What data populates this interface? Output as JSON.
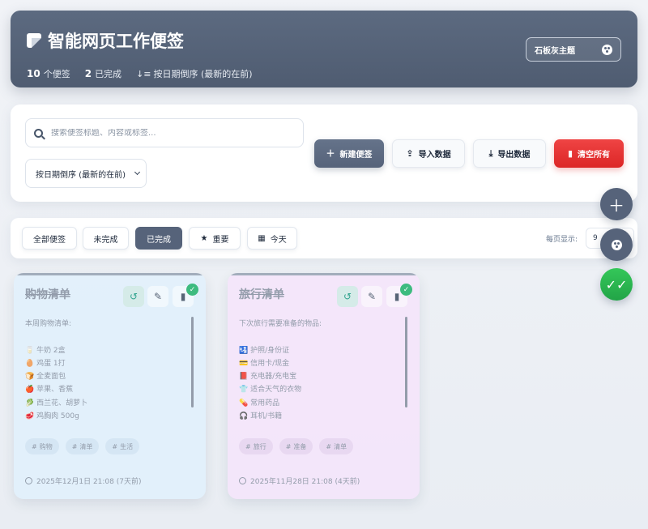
{
  "header": {
    "title": "智能网页工作便签",
    "stats": [
      {
        "count": "10",
        "label": "个便签"
      },
      {
        "count": "2",
        "label": "已完成"
      }
    ],
    "sort_label": "按日期倒序 (最新的在前)",
    "theme_label": "石板灰主题"
  },
  "toolbar": {
    "search_placeholder": "搜索便签标题、内容或标签...",
    "sort_value": "按日期倒序 (最新的在前)",
    "new_label": "新建便签",
    "import_label": "导入数据",
    "export_label": "导出数据",
    "clear_label": "清空所有"
  },
  "filters": {
    "items": [
      "全部便签",
      "未完成",
      "已完成",
      "重要",
      "今天"
    ],
    "active": "已完成",
    "per_page_label": "每页显示:",
    "per_page_value": "9"
  },
  "notes": [
    {
      "title": "购物清单",
      "content": "本周购物清单:\n\n🥛 牛奶 2盒\n🥚 鸡蛋 1打\n🍞 全麦面包\n🍎 苹果、香蕉\n🥬 西兰花、胡萝卜\n🥩 鸡胸肉 500g",
      "tags": [
        "购物",
        "清单",
        "生活"
      ],
      "date": "2025年12月1日 21:08 (7天前)"
    },
    {
      "title": "旅行清单",
      "content": "下次旅行需要准备的物品:\n\n🛂 护照/身份证\n💳 信用卡/现金\n📕 充电器/充电宝\n👕 适合天气的衣物\n💊 常用药品\n🎧 耳机/书籍",
      "tags": [
        "旅行",
        "准备",
        "清单"
      ],
      "date": "2025年11月28日 21:08 (4天前)"
    }
  ],
  "colors": {
    "slate": "#56637a",
    "danger": "#dc2626",
    "success": "#22a447"
  }
}
